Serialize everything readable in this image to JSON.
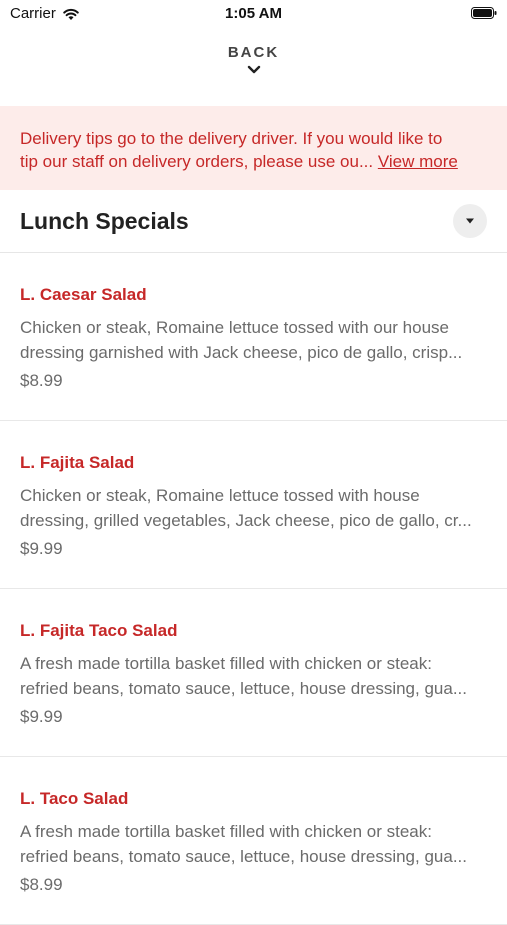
{
  "status_bar": {
    "carrier": "Carrier",
    "time": "1:05 AM"
  },
  "nav": {
    "back_label": "BACK"
  },
  "banner": {
    "line1": "Delivery tips go to the delivery driver. If you would like to",
    "line2": "tip our staff on delivery orders, please use ou...",
    "view_more": "View more"
  },
  "section": {
    "title": "Lunch Specials"
  },
  "menu_items": [
    {
      "name": "L. Caesar Salad",
      "desc_line1": "Chicken or steak, Romaine lettuce tossed with our house",
      "desc_line2": "dressing garnished with Jack cheese, pico de gallo, crisp...",
      "price": "$8.99"
    },
    {
      "name": "L. Fajita Salad",
      "desc_line1": "Chicken or steak, Romaine lettuce tossed with house",
      "desc_line2": "dressing, grilled vegetables, Jack cheese, pico de gallo, cr...",
      "price": "$9.99"
    },
    {
      "name": "L. Fajita Taco Salad",
      "desc_line1": "A fresh made tortilla basket filled with chicken or steak:",
      "desc_line2": "refried beans, tomato sauce, lettuce, house dressing, gua...",
      "price": "$9.99"
    },
    {
      "name": "L. Taco Salad",
      "desc_line1": "A fresh made tortilla basket filled with chicken or steak:",
      "desc_line2": "refried beans, tomato sauce, lettuce, house dressing, gua...",
      "price": "$8.99"
    }
  ],
  "icons": {
    "wifi": "wifi-icon",
    "battery": "battery-icon",
    "back_chevron": "chevron-down-icon",
    "dropdown": "caret-down-icon"
  },
  "colors": {
    "accent": "#c62828",
    "banner_bg": "#fdecea",
    "muted_text": "#6b6b6b"
  }
}
